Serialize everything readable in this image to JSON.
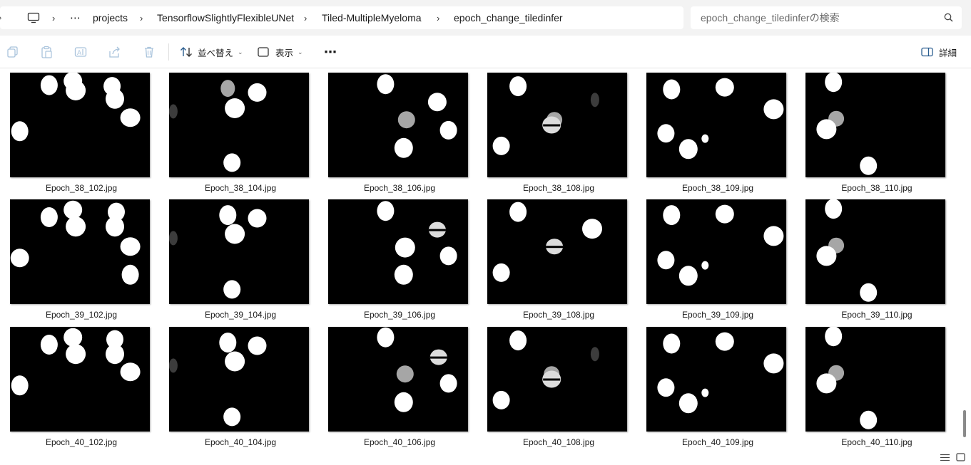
{
  "breadcrumb": {
    "items": [
      "projects",
      "TensorflowSlightlyFlexibleUNet",
      "Tiled-MultipleMyeloma",
      "epoch_change_tiledinfer"
    ],
    "overflow": "⋯",
    "separator": "›"
  },
  "search": {
    "placeholder": "epoch_change_tiledinferの検索"
  },
  "toolbar": {
    "sort_label": "並べ替え",
    "view_label": "表示",
    "more": "⋯",
    "details_label": "詳細"
  },
  "files": [
    {
      "name": "Epoch_38_102.jpg",
      "cells": [
        [
          28,
          12,
          "p"
        ],
        [
          45,
          8,
          "p"
        ],
        [
          47,
          17,
          "p"
        ],
        [
          73,
          13,
          "p"
        ],
        [
          75,
          25,
          "p"
        ],
        [
          86,
          43,
          "p"
        ],
        [
          7,
          56,
          "p"
        ]
      ]
    },
    {
      "name": "Epoch_38_104.jpg",
      "cells": [
        [
          42,
          15,
          "g"
        ],
        [
          63,
          19,
          "p"
        ],
        [
          47,
          34,
          "p"
        ],
        [
          45,
          86,
          "p"
        ],
        [
          3,
          37,
          "f"
        ]
      ]
    },
    {
      "name": "Epoch_38_106.jpg",
      "cells": [
        [
          41,
          11,
          "p"
        ],
        [
          78,
          28,
          "p"
        ],
        [
          56,
          45,
          "g"
        ],
        [
          86,
          55,
          "p"
        ],
        [
          54,
          72,
          "p"
        ]
      ]
    },
    {
      "name": "Epoch_38_108.jpg",
      "cells": [
        [
          22,
          13,
          "p"
        ],
        [
          48,
          45,
          "g"
        ],
        [
          46,
          50,
          "c"
        ],
        [
          10,
          70,
          "p"
        ],
        [
          77,
          26,
          "f"
        ]
      ]
    },
    {
      "name": "Epoch_38_109.jpg",
      "cells": [
        [
          18,
          16,
          "p"
        ],
        [
          56,
          14,
          "p"
        ],
        [
          91,
          35,
          "p"
        ],
        [
          14,
          58,
          "p"
        ],
        [
          30,
          73,
          "p"
        ],
        [
          42,
          63,
          "s"
        ]
      ]
    },
    {
      "name": "Epoch_38_110.jpg",
      "cells": [
        [
          20,
          9,
          "p"
        ],
        [
          22,
          44,
          "g"
        ],
        [
          15,
          54,
          "p"
        ],
        [
          45,
          89,
          "p"
        ]
      ]
    },
    {
      "name": "Epoch_39_102.jpg",
      "cells": [
        [
          28,
          17,
          "p"
        ],
        [
          45,
          10,
          "p"
        ],
        [
          47,
          26,
          "p"
        ],
        [
          76,
          12,
          "p"
        ],
        [
          75,
          26,
          "p"
        ],
        [
          86,
          45,
          "p"
        ],
        [
          86,
          72,
          "p"
        ],
        [
          7,
          56,
          "p"
        ]
      ]
    },
    {
      "name": "Epoch_39_104.jpg",
      "cells": [
        [
          42,
          15,
          "p"
        ],
        [
          63,
          18,
          "p"
        ],
        [
          47,
          33,
          "p"
        ],
        [
          45,
          86,
          "p"
        ],
        [
          3,
          37,
          "f"
        ]
      ]
    },
    {
      "name": "Epoch_39_106.jpg",
      "cells": [
        [
          41,
          11,
          "p"
        ],
        [
          78,
          29,
          "c"
        ],
        [
          55,
          46,
          "p"
        ],
        [
          86,
          54,
          "p"
        ],
        [
          54,
          72,
          "p"
        ]
      ]
    },
    {
      "name": "Epoch_39_108.jpg",
      "cells": [
        [
          22,
          12,
          "p"
        ],
        [
          48,
          45,
          "c"
        ],
        [
          75,
          28,
          "p"
        ],
        [
          10,
          70,
          "p"
        ]
      ]
    },
    {
      "name": "Epoch_39_109.jpg",
      "cells": [
        [
          18,
          15,
          "p"
        ],
        [
          56,
          14,
          "p"
        ],
        [
          91,
          35,
          "p"
        ],
        [
          14,
          58,
          "p"
        ],
        [
          30,
          73,
          "p"
        ],
        [
          42,
          63,
          "s"
        ]
      ]
    },
    {
      "name": "Epoch_39_110.jpg",
      "cells": [
        [
          20,
          9,
          "p"
        ],
        [
          22,
          44,
          "g"
        ],
        [
          15,
          54,
          "p"
        ],
        [
          45,
          89,
          "p"
        ]
      ]
    },
    {
      "name": "Epoch_40_102.jpg",
      "cells": [
        [
          28,
          17,
          "p"
        ],
        [
          45,
          10,
          "p"
        ],
        [
          47,
          26,
          "p"
        ],
        [
          75,
          12,
          "p"
        ],
        [
          75,
          26,
          "p"
        ],
        [
          86,
          43,
          "p"
        ],
        [
          7,
          56,
          "p"
        ]
      ]
    },
    {
      "name": "Epoch_40_104.jpg",
      "cells": [
        [
          42,
          15,
          "p"
        ],
        [
          63,
          18,
          "p"
        ],
        [
          47,
          33,
          "p"
        ],
        [
          45,
          86,
          "p"
        ],
        [
          3,
          37,
          "f"
        ]
      ]
    },
    {
      "name": "Epoch_40_106.jpg",
      "cells": [
        [
          41,
          10,
          "p"
        ],
        [
          79,
          29,
          "c"
        ],
        [
          55,
          45,
          "g"
        ],
        [
          86,
          54,
          "p"
        ],
        [
          54,
          72,
          "p"
        ]
      ]
    },
    {
      "name": "Epoch_40_108.jpg",
      "cells": [
        [
          22,
          13,
          "p"
        ],
        [
          46,
          45,
          "g"
        ],
        [
          46,
          50,
          "c"
        ],
        [
          10,
          70,
          "p"
        ],
        [
          77,
          26,
          "f"
        ]
      ]
    },
    {
      "name": "Epoch_40_109.jpg",
      "cells": [
        [
          18,
          16,
          "p"
        ],
        [
          56,
          14,
          "p"
        ],
        [
          91,
          35,
          "p"
        ],
        [
          14,
          58,
          "p"
        ],
        [
          30,
          73,
          "p"
        ],
        [
          42,
          63,
          "s"
        ]
      ]
    },
    {
      "name": "Epoch_40_110.jpg",
      "cells": [
        [
          20,
          9,
          "p"
        ],
        [
          22,
          44,
          "g"
        ],
        [
          15,
          54,
          "p"
        ],
        [
          45,
          89,
          "p"
        ]
      ]
    }
  ]
}
